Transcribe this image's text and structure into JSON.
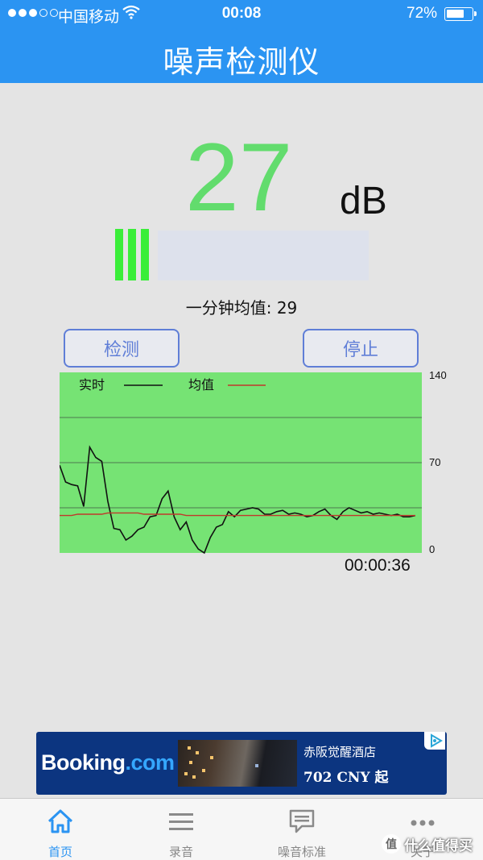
{
  "status_bar": {
    "carrier": "中国移动",
    "time": "00:08",
    "battery_percent": "72%",
    "battery_level": 0.72,
    "signal_bars_filled": 3,
    "signal_bars_total": 5
  },
  "nav": {
    "title": "噪声检测仪"
  },
  "reading": {
    "value": "27",
    "unit": "dB",
    "meter_segments_lit": 3,
    "minute_avg_label": "一分钟均值: 29"
  },
  "buttons": {
    "detect": "检测",
    "stop": "停止"
  },
  "elapsed": "00:00:36",
  "colors": {
    "accent": "#2b94f2",
    "reading_green": "#62dc6d",
    "chart_bg": "#76e374",
    "meter_green": "#3aee39",
    "button_border": "#5f7ed7",
    "avg_line": "#c0392b"
  },
  "chart_data": {
    "type": "line",
    "legend": [
      {
        "name": "实时",
        "color": "#111111"
      },
      {
        "name": "均值",
        "color": "#c0392b"
      }
    ],
    "y_ticks": [
      "140",
      "70",
      "0"
    ],
    "ylim": [
      0,
      140
    ],
    "grid_y": [
      0,
      35,
      70,
      105,
      140
    ],
    "x": [
      0,
      1,
      2,
      3,
      4,
      5,
      6,
      7,
      8,
      9,
      10,
      11,
      12,
      13,
      14,
      15,
      16,
      17,
      18,
      19,
      20,
      21,
      22,
      23,
      24,
      25,
      26,
      27,
      28,
      29,
      30,
      31,
      32,
      33,
      34,
      35,
      36,
      37,
      38,
      39,
      40,
      41,
      42,
      43,
      44,
      45,
      46,
      47,
      48,
      49,
      50,
      51,
      52,
      53,
      54,
      55,
      56,
      57,
      58,
      59
    ],
    "series": [
      {
        "name": "实时",
        "values": [
          68,
          55,
          53,
          52,
          36,
          82,
          74,
          71,
          40,
          19,
          18,
          10,
          13,
          18,
          20,
          28,
          29,
          42,
          48,
          28,
          18,
          24,
          10,
          3,
          0,
          12,
          20,
          22,
          32,
          28,
          33,
          34,
          35,
          34,
          30,
          30,
          32,
          33,
          30,
          31,
          30,
          28,
          29,
          32,
          34,
          29,
          26,
          32,
          35,
          33,
          31,
          32,
          30,
          31,
          30,
          29,
          30,
          28,
          28,
          29
        ],
        "color": "#111111"
      },
      {
        "name": "均值",
        "values": [
          29,
          29,
          29,
          30,
          30,
          30,
          30,
          30,
          31,
          31,
          31,
          31,
          31,
          31,
          30,
          30,
          30,
          30,
          30,
          30,
          30,
          29,
          29,
          29,
          29,
          29,
          29,
          29,
          29,
          29,
          29,
          29,
          29,
          29,
          29,
          29,
          29,
          29,
          29,
          29,
          29,
          29,
          29,
          29,
          29,
          29,
          29,
          29,
          29,
          29,
          29,
          29,
          29,
          29,
          29,
          29,
          29,
          29,
          29,
          29
        ],
        "color": "#c0392b"
      }
    ]
  },
  "ad": {
    "brand": "Booking",
    "brand_suffix": ".com",
    "hotel": "赤阪觉醒酒店",
    "price": "702 CNY 起"
  },
  "tabs": [
    {
      "label": "首页",
      "icon": "home-icon",
      "active": true
    },
    {
      "label": "录音",
      "icon": "list-icon",
      "active": false
    },
    {
      "label": "噪音标准",
      "icon": "chat-bubble-icon",
      "active": false
    },
    {
      "label": "关于",
      "icon": "more-icon",
      "active": false
    }
  ],
  "watermark": {
    "text": "什么值得买",
    "icon_glyph": "值"
  }
}
